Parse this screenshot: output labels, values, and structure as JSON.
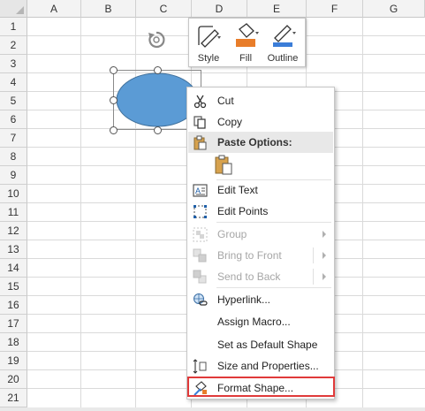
{
  "columns": [
    "A",
    "B",
    "C",
    "D",
    "E",
    "F",
    "G"
  ],
  "rows": [
    "1",
    "2",
    "3",
    "4",
    "5",
    "6",
    "7",
    "8",
    "9",
    "10",
    "11",
    "12",
    "13",
    "14",
    "15",
    "16",
    "17",
    "18",
    "19",
    "20",
    "21"
  ],
  "mini_toolbar": {
    "style_label": "Style",
    "fill_label": "Fill",
    "outline_label": "Outline",
    "fill_color": "#e87d2a",
    "outline_color": "#3b7dd8"
  },
  "shape": {
    "fill_color": "#5b9bd5"
  },
  "context_menu": {
    "cut": "Cut",
    "copy": "Copy",
    "paste_options": "Paste Options:",
    "edit_text": "Edit Text",
    "edit_points": "Edit Points",
    "group": "Group",
    "bring_to_front": "Bring to Front",
    "send_to_back": "Send to Back",
    "hyperlink": "Hyperlink...",
    "assign_macro": "Assign Macro...",
    "set_default": "Set as Default Shape",
    "size_properties": "Size and Properties...",
    "format_shape": "Format Shape..."
  },
  "highlight_color": "#e03a3a"
}
